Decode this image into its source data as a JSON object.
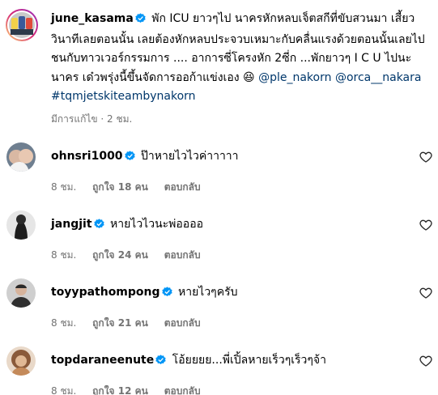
{
  "post": {
    "username": "june_kasama",
    "caption_text": "พัก ICU ยาวๆไป นาครหักหลบเจ็ตสกีที่ขับสวนมา เสี้ยววินาทีเลยตอนนั้น เลยต้องหักหลบประจวบเหมาะกับคลื่นแรงด้วยตอนนั้นเลยไปชนกับทาวเวอร์กรรมการ .... อาการซี่โครงหัก 2ซี่ก ...พักยาวๆ I C U ไปนะนาคร เด๋วพรุ่งนี้ขึ้นจัดการออก้าแข่งเอง",
    "emoji": "😆",
    "mention_1": "@ple_nakorn",
    "mention_2": "@orca__nakara",
    "hashtag": "#tqmjetskiteambynakorn",
    "meta": "มีการแก้ไข · 2 ชม."
  },
  "comments": [
    {
      "username": "ohnsri1000",
      "text": "ป๊าหายไวไวค่าาาาา",
      "time": "8 ชม.",
      "likes": "ถูกใจ 18 คน",
      "reply": "ตอบกลับ"
    },
    {
      "username": "jangjit",
      "text": "หายไวไวนะพ่ออออ",
      "time": "8 ชม.",
      "likes": "ถูกใจ 24 คน",
      "reply": "ตอบกลับ"
    },
    {
      "username": "toyypathompong",
      "text": "หายไวๆครับ",
      "time": "8 ชม.",
      "likes": "ถูกใจ 21 คน",
      "reply": "ตอบกลับ"
    },
    {
      "username": "topdaraneenute",
      "text": "โอ้ยยยย...พี่เปิ้ลหายเร็วๆเร็วๆจ้า",
      "time": "8 ชม.",
      "likes": "ถูกใจ 12 คน",
      "reply": "ตอบกลับ"
    }
  ],
  "colors": {
    "link": "#00376b",
    "secondary_text": "#737373",
    "verified": "#0095f6"
  }
}
